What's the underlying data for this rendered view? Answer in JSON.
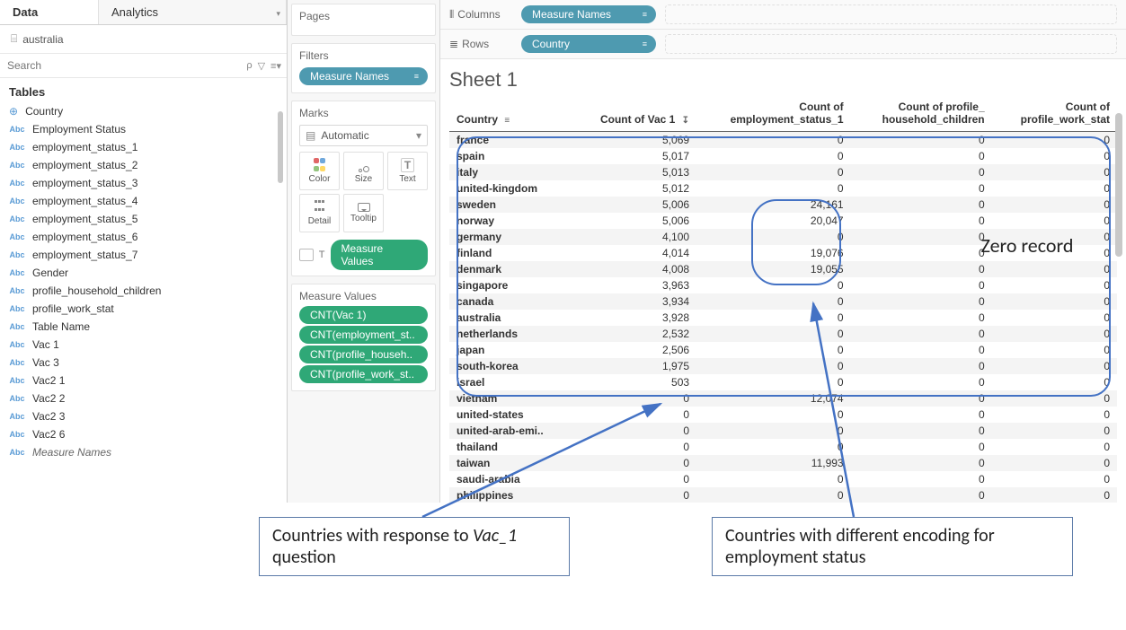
{
  "tabs": {
    "data": "Data",
    "analytics": "Analytics"
  },
  "datasource": "australia",
  "search_placeholder": "Search",
  "tables_header": "Tables",
  "fields": [
    {
      "type": "globe",
      "label": "Country"
    },
    {
      "type": "abc",
      "label": "Employment Status"
    },
    {
      "type": "abc",
      "label": "employment_status_1"
    },
    {
      "type": "abc",
      "label": "employment_status_2"
    },
    {
      "type": "abc",
      "label": "employment_status_3"
    },
    {
      "type": "abc",
      "label": "employment_status_4"
    },
    {
      "type": "abc",
      "label": "employment_status_5"
    },
    {
      "type": "abc",
      "label": "employment_status_6"
    },
    {
      "type": "abc",
      "label": "employment_status_7"
    },
    {
      "type": "abc",
      "label": "Gender"
    },
    {
      "type": "abc",
      "label": "profile_household_children"
    },
    {
      "type": "abc",
      "label": "profile_work_stat"
    },
    {
      "type": "abc",
      "label": "Table Name"
    },
    {
      "type": "abc",
      "label": "Vac 1"
    },
    {
      "type": "abc",
      "label": "Vac 3"
    },
    {
      "type": "abc",
      "label": "Vac2 1"
    },
    {
      "type": "abc",
      "label": "Vac2 2"
    },
    {
      "type": "abc",
      "label": "Vac2 3"
    },
    {
      "type": "abc",
      "label": "Vac2 6"
    },
    {
      "type": "abc",
      "label": "Measure Names",
      "italic": true
    }
  ],
  "shelves": {
    "pages": "Pages",
    "filters": "Filters",
    "filters_pill": "Measure Names",
    "marks": "Marks",
    "marks_type": "Automatic",
    "mark_buttons": {
      "color": "Color",
      "size": "Size",
      "text": "Text",
      "detail": "Detail",
      "tooltip": "Tooltip"
    },
    "measure_values_label": "Measure Values",
    "measure_values_title": "Measure Values",
    "measure_value_pills": [
      "CNT(Vac 1)",
      "CNT(employment_st..",
      "CNT(profile_househ..",
      "CNT(profile_work_st.."
    ]
  },
  "top_shelves": {
    "columns_label": "Columns",
    "columns_pill": "Measure Names",
    "rows_label": "Rows",
    "rows_pill": "Country"
  },
  "sheet_title": "Sheet 1",
  "table_headers": {
    "country": "Country",
    "vac1": "Count of Vac 1",
    "emp": "Count of\nemployment_status_1",
    "house": "Count of profile_\nhousehold_children",
    "work": "Count of\nprofile_work_stat"
  },
  "rows": [
    {
      "c": "france",
      "v1": "5,069",
      "e": "0",
      "h": "0",
      "w": "0"
    },
    {
      "c": "spain",
      "v1": "5,017",
      "e": "0",
      "h": "0",
      "w": "0"
    },
    {
      "c": "italy",
      "v1": "5,013",
      "e": "0",
      "h": "0",
      "w": "0"
    },
    {
      "c": "united-kingdom",
      "v1": "5,012",
      "e": "0",
      "h": "0",
      "w": "0"
    },
    {
      "c": "sweden",
      "v1": "5,006",
      "e": "24,161",
      "h": "0",
      "w": "0"
    },
    {
      "c": "norway",
      "v1": "5,006",
      "e": "20,047",
      "h": "0",
      "w": "0"
    },
    {
      "c": "germany",
      "v1": "4,100",
      "e": "0",
      "h": "0",
      "w": "0"
    },
    {
      "c": "finland",
      "v1": "4,014",
      "e": "19,076",
      "h": "0",
      "w": "0"
    },
    {
      "c": "denmark",
      "v1": "4,008",
      "e": "19,055",
      "h": "0",
      "w": "0"
    },
    {
      "c": "singapore",
      "v1": "3,963",
      "e": "0",
      "h": "0",
      "w": "0"
    },
    {
      "c": "canada",
      "v1": "3,934",
      "e": "0",
      "h": "0",
      "w": "0"
    },
    {
      "c": "australia",
      "v1": "3,928",
      "e": "0",
      "h": "0",
      "w": "0"
    },
    {
      "c": "netherlands",
      "v1": "2,532",
      "e": "0",
      "h": "0",
      "w": "0"
    },
    {
      "c": "japan",
      "v1": "2,506",
      "e": "0",
      "h": "0",
      "w": "0"
    },
    {
      "c": "south-korea",
      "v1": "1,975",
      "e": "0",
      "h": "0",
      "w": "0"
    },
    {
      "c": "israel",
      "v1": "503",
      "e": "0",
      "h": "0",
      "w": "0"
    },
    {
      "c": "vietnam",
      "v1": "0",
      "e": "12,074",
      "h": "0",
      "w": "0"
    },
    {
      "c": "united-states",
      "v1": "0",
      "e": "0",
      "h": "0",
      "w": "0"
    },
    {
      "c": "united-arab-emi..",
      "v1": "0",
      "e": "0",
      "h": "0",
      "w": "0"
    },
    {
      "c": "thailand",
      "v1": "0",
      "e": "0",
      "h": "0",
      "w": "0"
    },
    {
      "c": "taiwan",
      "v1": "0",
      "e": "11,993",
      "h": "0",
      "w": "0"
    },
    {
      "c": "saudi-arabia",
      "v1": "0",
      "e": "0",
      "h": "0",
      "w": "0"
    },
    {
      "c": "philippines",
      "v1": "0",
      "e": "0",
      "h": "0",
      "w": "0"
    }
  ],
  "annotations": {
    "vac1": "Countries with response to Vac_1 question",
    "emp": "Countries with different encoding for employment status",
    "zero": "Zero record"
  }
}
